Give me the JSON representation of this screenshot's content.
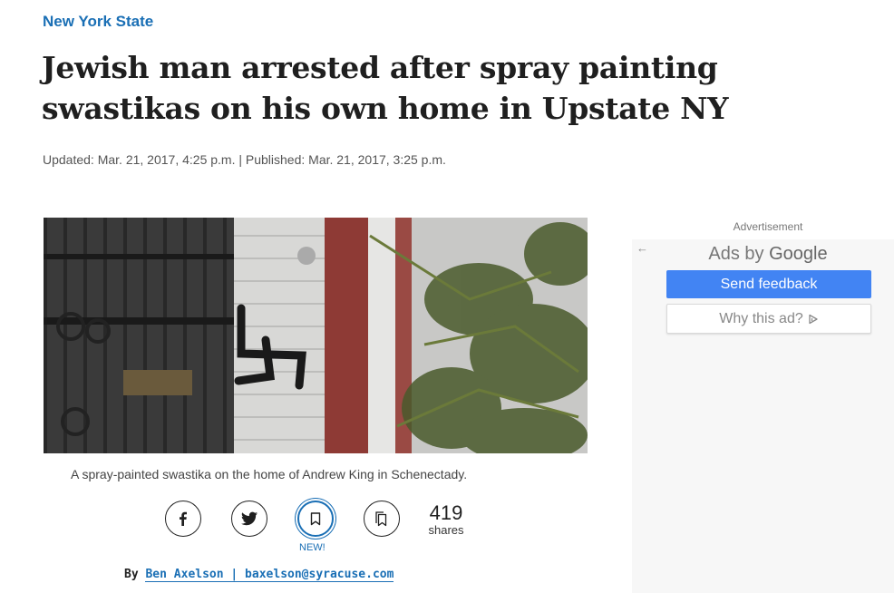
{
  "article": {
    "section": "New York State",
    "headline": "Jewish man arrested after spray painting swastikas on his own home in Upstate NY",
    "dateline": "Updated: Mar. 21, 2017, 4:25 p.m. | Published: Mar. 21, 2017, 3:25 p.m.",
    "caption": "A spray-painted swastika on the home of Andrew King in Schenectady.",
    "byline": {
      "prefix": "By",
      "author": "Ben Axelson | baxelson@syracuse.com"
    }
  },
  "share": {
    "buttons": [
      {
        "name": "facebook",
        "icon": "facebook-icon"
      },
      {
        "name": "twitter",
        "icon": "twitter-icon"
      },
      {
        "name": "save",
        "icon": "bookmark-icon"
      },
      {
        "name": "saved",
        "icon": "saved-bookmarks-icon"
      }
    ],
    "new_label": "NEW!",
    "count": "419",
    "count_label": "shares"
  },
  "ad": {
    "label": "Advertisement",
    "back_icon": "arrow-left-icon",
    "ads_by": "Ads by",
    "google": "Google",
    "feedback_label": "Send feedback",
    "why_label": "Why this ad?",
    "why_icon": "adchoices-icon"
  },
  "colors": {
    "link_blue": "#1a6fb5",
    "feedback_blue": "#4284f3",
    "text": "#1f1f1f",
    "muted": "#555555"
  }
}
